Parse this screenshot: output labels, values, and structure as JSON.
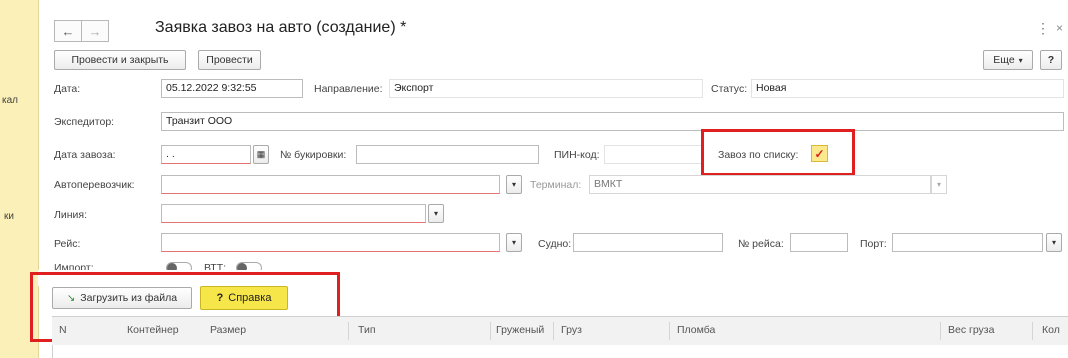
{
  "window": {
    "title": "Заявка завоз на авто (создание) *",
    "back_icon": "←",
    "forward_icon": "→",
    "menu_icon": "⋮",
    "close_icon": "×"
  },
  "left_strip": {
    "items": [
      "кал",
      "ки"
    ]
  },
  "toolbar": {
    "post_close_label": "Провести и закрыть",
    "post_label": "Провести",
    "more_label": "Еще",
    "more_icon": "▾",
    "help_label": "?"
  },
  "form": {
    "date_label": "Дата:",
    "date_value": "05.12.2022 9:32:55",
    "direction_label": "Направление:",
    "direction_value": "Экспорт",
    "status_label": "Статус:",
    "status_value": "Новая",
    "forwarder_label": "Экспедитор:",
    "forwarder_value": "Транзит ООО",
    "import_date_label": "Дата завоза:",
    "import_date_value": ". .",
    "calendar_icon": "▦",
    "booking_label": "№ букировки:",
    "booking_value": "",
    "pin_label": "ПИН-код:",
    "pin_value": "",
    "list_import_label": "Завоз по списку:",
    "list_import_checked": "✓",
    "carrier_label": "Автоперевозчик:",
    "carrier_value": "",
    "dropdown_icon": "▾",
    "terminal_label": "Терминал:",
    "terminal_value": "ВМКТ",
    "line_label": "Линия:",
    "line_value": "",
    "voyage_label": "Рейс:",
    "voyage_value": "",
    "vessel_label": "Судно:",
    "vessel_value": "",
    "voyage_no_label": "№ рейса:",
    "voyage_no_value": "",
    "port_label": "Порт:",
    "port_value": "",
    "import_label": "Импорт:",
    "vtt_label": "ВТТ:"
  },
  "table_toolbar": {
    "load_file_label": "Загрузить из файла",
    "load_file_icon": "↘",
    "reference_label": "Справка",
    "reference_icon": "?"
  },
  "table": {
    "columns": [
      "N",
      "Контейнер",
      "Размер",
      "Тип",
      "Груженый",
      "Груз",
      "Пломба",
      "Вес груза",
      "Кол"
    ]
  },
  "colors": {
    "accent_yellow": "#f7e64a",
    "left_strip": "#fbf0b8",
    "highlight_red": "#e02020"
  }
}
